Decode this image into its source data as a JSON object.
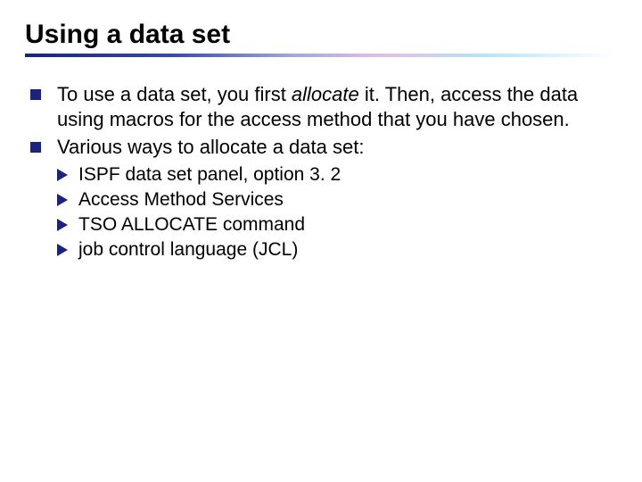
{
  "slide": {
    "title": "Using a data set",
    "bullets": [
      {
        "pre": "To use a data set, you first ",
        "emph": "allocate",
        "post": " it. Then, access the data using macros for the access method that you have chosen."
      },
      {
        "text": "Various ways to allocate a data set:"
      }
    ],
    "subbullets": [
      "ISPF data set panel, option 3. 2",
      "Access Method Services",
      "TSO ALLOCATE command",
      "job control language (JCL)"
    ]
  }
}
